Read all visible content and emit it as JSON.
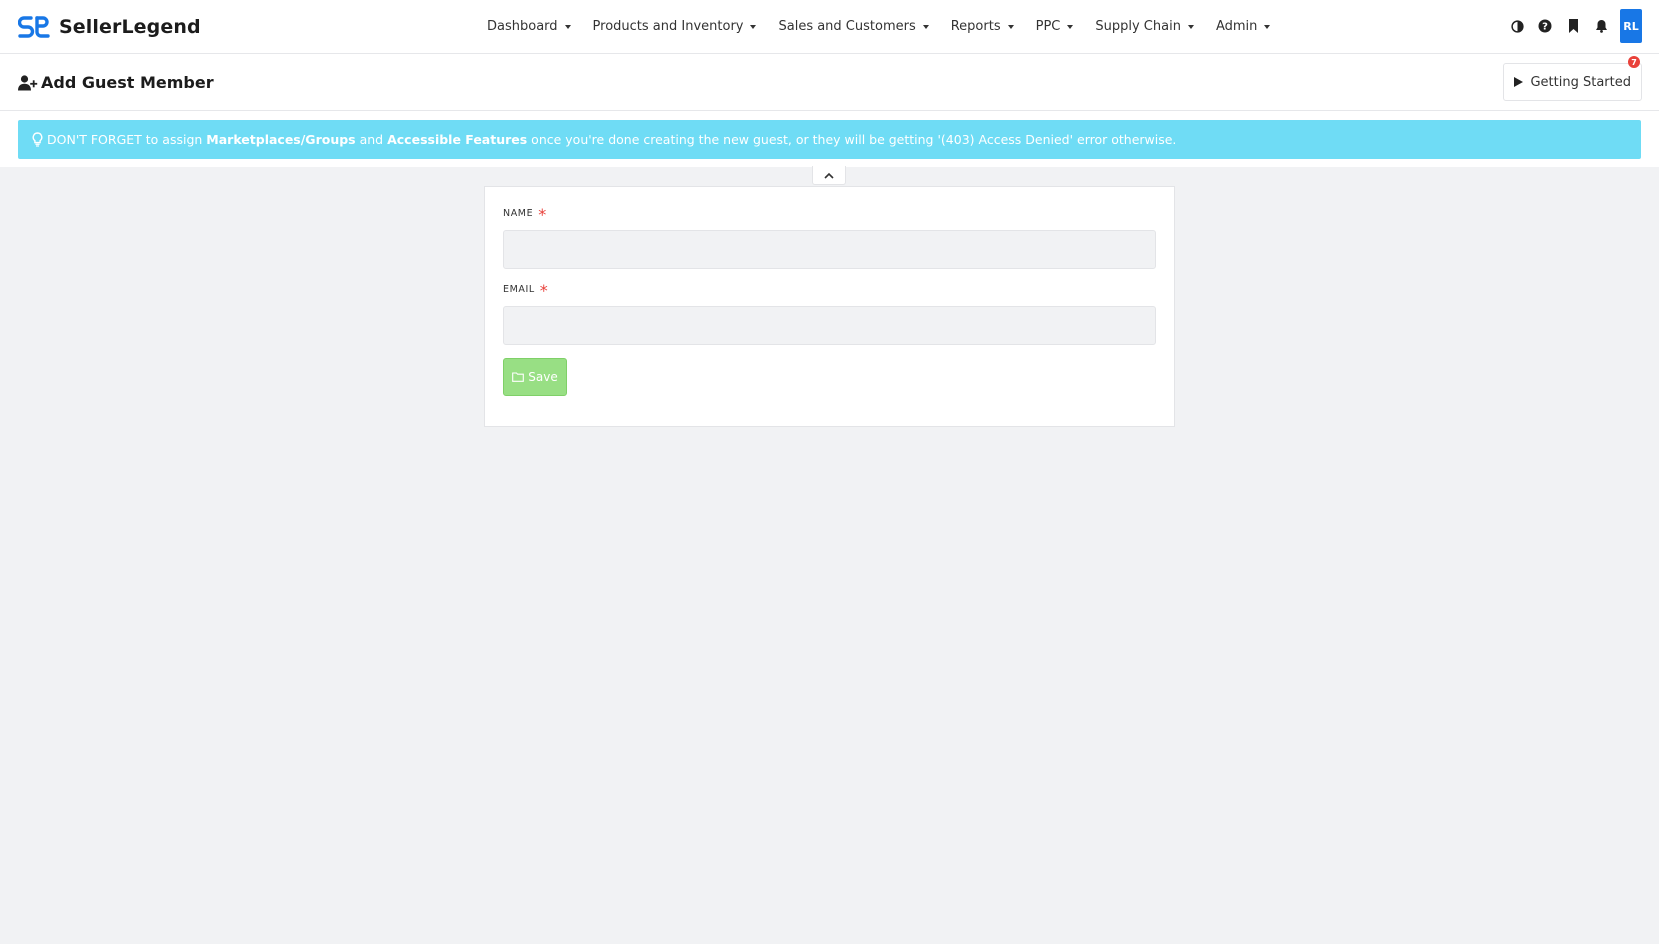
{
  "brand": {
    "name": "SellerLegend",
    "logo_icon": "sellerlegend-logo-icon",
    "accent": "#1877e6"
  },
  "nav": {
    "items": [
      {
        "label": "Dashboard"
      },
      {
        "label": "Products and Inventory"
      },
      {
        "label": "Sales and Customers"
      },
      {
        "label": "Reports"
      },
      {
        "label": "PPC"
      },
      {
        "label": "Supply Chain"
      },
      {
        "label": "Admin"
      }
    ],
    "icons": [
      "theme-toggle-icon",
      "help-icon",
      "bookmark-icon",
      "bell-icon"
    ],
    "avatar_initials": "RL"
  },
  "header": {
    "title": "Add Guest Member",
    "title_icon": "user-plus-icon",
    "getting_started_label": "Getting Started",
    "getting_started_badge": "7"
  },
  "alert": {
    "icon": "lightbulb-icon",
    "text_1": "DON'T FORGET to assign ",
    "bold_1": "Marketplaces/Groups",
    "text_2": " and ",
    "bold_2": "Accessible Features",
    "text_3": " once you're done creating the new guest, or they will be getting '(403) Access Denied' error otherwise.",
    "color": "#6fdcf5"
  },
  "form": {
    "name_label": "NAME",
    "name_value": "",
    "email_label": "EMAIL",
    "email_value": "",
    "required_mark": "*",
    "save_label": "Save",
    "save_color": "#98df84"
  }
}
